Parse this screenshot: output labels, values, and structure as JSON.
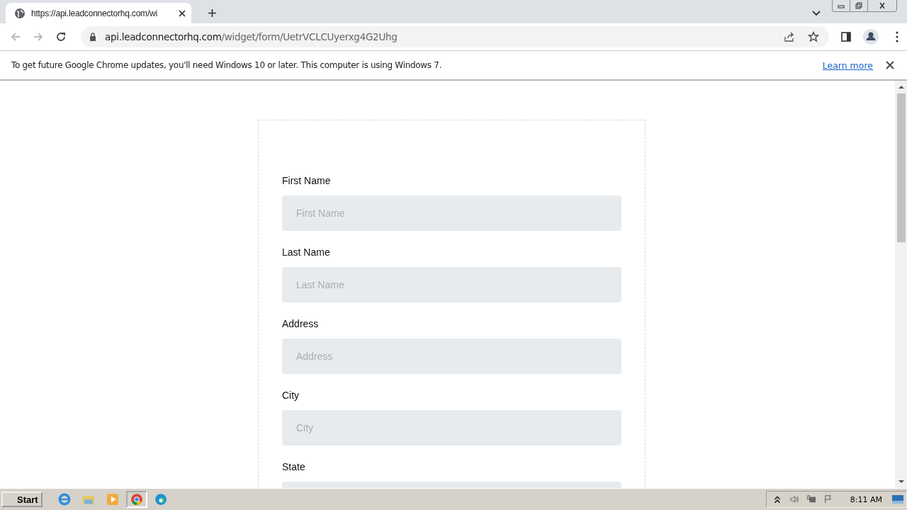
{
  "browser": {
    "tab": {
      "title": "https://api.leadconnectorhq.com/wi",
      "selected": true
    },
    "address": {
      "host": "api.leadconnectorhq.com",
      "path": "/widget/form/UetrVCLCUyerxg4G2Uhg"
    },
    "infobar": {
      "message": "To get future Google Chrome updates, you'll need Windows 10 or later. This computer is using Windows 7.",
      "link": "Learn more"
    }
  },
  "form": {
    "fields": [
      {
        "label": "First Name",
        "placeholder": "First Name"
      },
      {
        "label": "Last Name",
        "placeholder": "Last Name"
      },
      {
        "label": "Address",
        "placeholder": "Address"
      },
      {
        "label": "City",
        "placeholder": "City"
      },
      {
        "label": "State"
      }
    ]
  },
  "taskbar": {
    "start": "Start",
    "clock": "8:11 AM"
  }
}
